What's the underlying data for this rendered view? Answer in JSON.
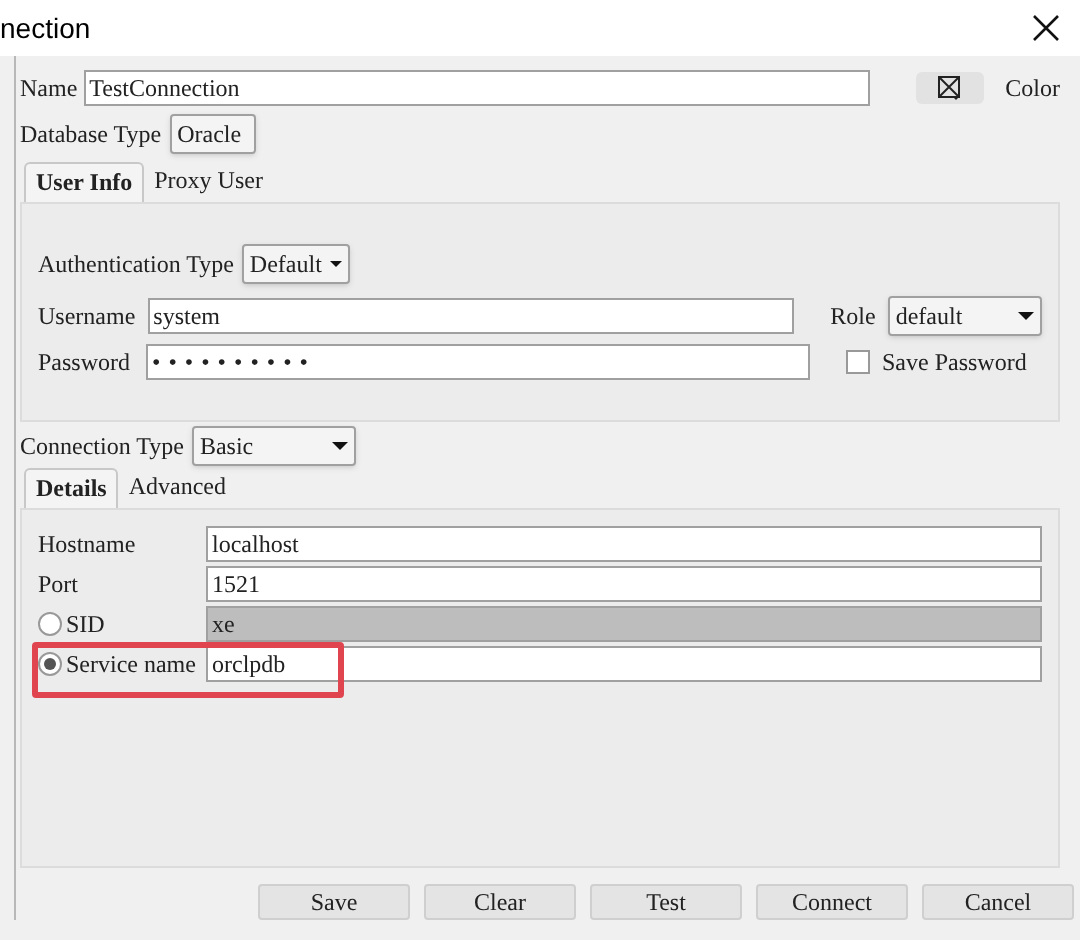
{
  "window": {
    "title": "nection"
  },
  "name": {
    "label": "Name",
    "value": "TestConnection"
  },
  "color_button": {
    "label": "Color"
  },
  "database_type": {
    "label": "Database Type",
    "value": "Oracle"
  },
  "tabs": [
    {
      "label": "User Info",
      "selected": true
    },
    {
      "label": "Proxy User",
      "selected": false
    }
  ],
  "authentication_type": {
    "label": "Authentication Type",
    "value": "Default"
  },
  "username": {
    "label": "Username",
    "value": "system"
  },
  "password": {
    "label": "Password",
    "value": "••••••••••"
  },
  "role": {
    "label": "Role",
    "value": "default"
  },
  "save_password": {
    "label": "Save Password",
    "checked": false
  },
  "connection_type": {
    "label": "Connection Type",
    "value": "Basic"
  },
  "detail_tabs": [
    {
      "label": "Details",
      "selected": true
    },
    {
      "label": "Advanced",
      "selected": false
    }
  ],
  "hostname": {
    "label": "Hostname",
    "value": "localhost"
  },
  "port": {
    "label": "Port",
    "value": "1521"
  },
  "connect_by": [
    {
      "label": "SID",
      "selected": false,
      "value": "xe"
    },
    {
      "label": "Service name",
      "selected": true,
      "value": "orclpdb"
    }
  ],
  "buttons": [
    "Save",
    "Clear",
    "Test",
    "Connect",
    "Cancel"
  ]
}
